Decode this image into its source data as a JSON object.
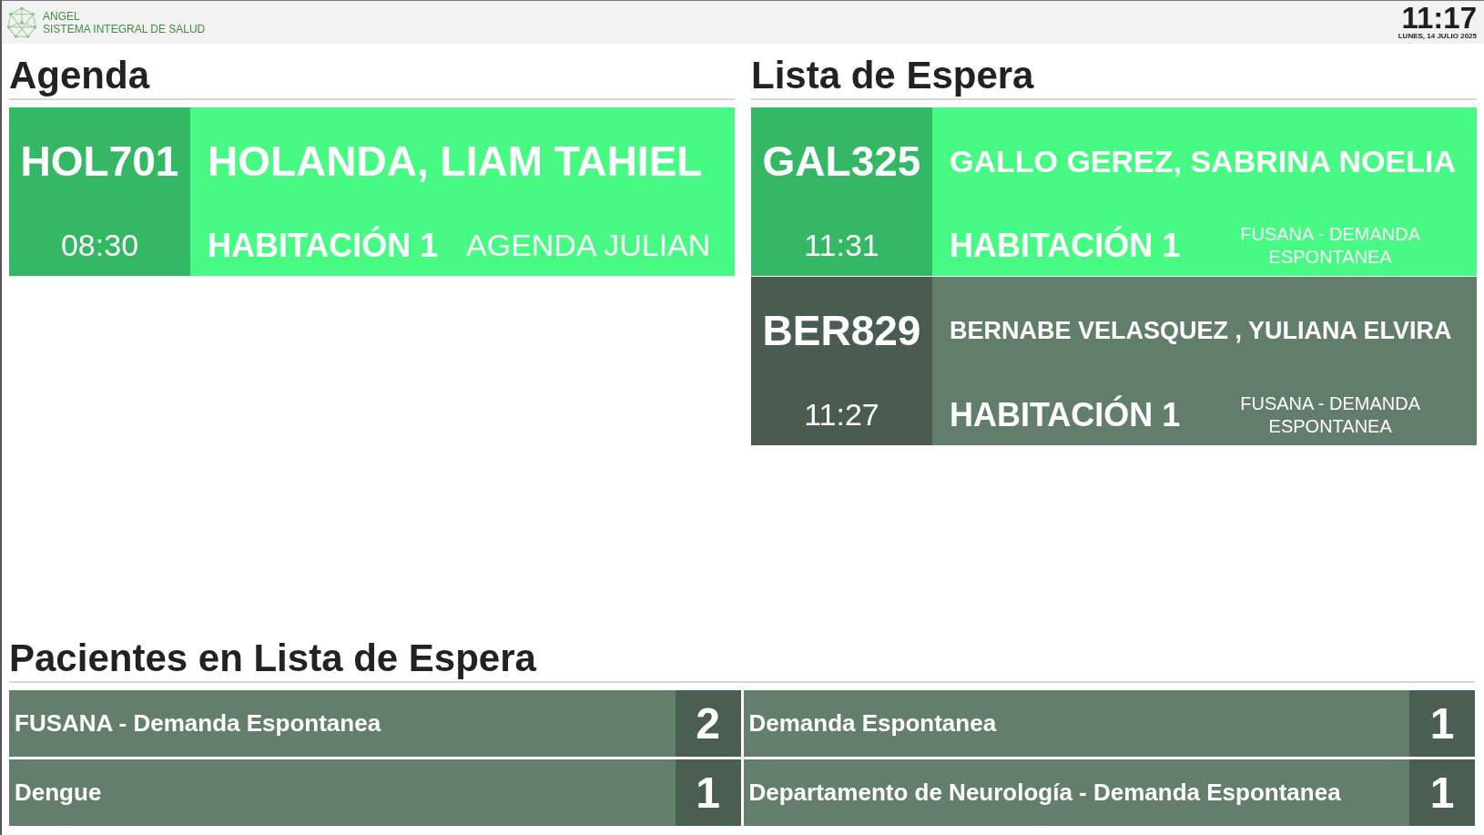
{
  "header": {
    "brand": "ANGEL",
    "subtitle": "SISTEMA INTEGRAL DE SALUD",
    "time": "11:17",
    "date": "LUNES, 14 JULIO 2025"
  },
  "agenda": {
    "title": "Agenda",
    "calls": [
      {
        "code": "HOL701",
        "time": "08:30",
        "name": "HOLANDA, LIAM TAHIEL",
        "room": "HABITACIÓN 1",
        "service": "AGENDA JULIAN",
        "called": true
      }
    ]
  },
  "waiting_list": {
    "title": "Lista de Espera",
    "calls": [
      {
        "code": "GAL325",
        "time": "11:31",
        "name": "GALLO GEREZ, SABRINA NOELIA",
        "room": "HABITACIÓN 1",
        "service": "FUSANA - DEMANDA ESPONTANEA",
        "called": true
      },
      {
        "code": "BER829",
        "time": "11:27",
        "name": "BERNABE VELASQUEZ , YULIANA ELVIRA",
        "room": "HABITACIÓN 1",
        "service": "FUSANA - DEMANDA ESPONTANEA",
        "called": false
      }
    ]
  },
  "waiting_counts": {
    "title": "Pacientes en Lista de Espera",
    "items": [
      {
        "service": "FUSANA - Demanda Espontanea",
        "count": "2"
      },
      {
        "service": "Demanda Espontanea",
        "count": "1"
      },
      {
        "service": "Dengue",
        "count": "1"
      },
      {
        "service": "Departamento de Neurología - Demanda Espontanea",
        "count": "1"
      }
    ]
  }
}
